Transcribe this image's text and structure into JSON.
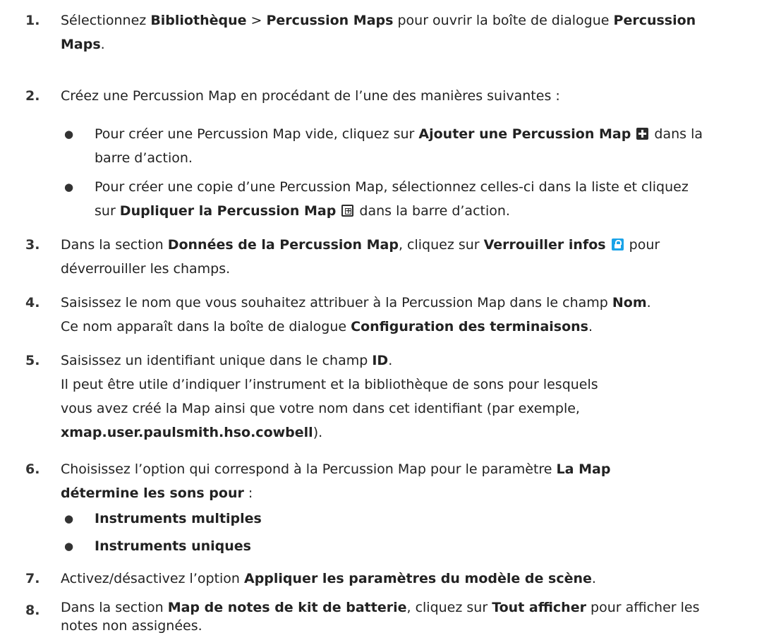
{
  "steps": [
    {
      "num": "1.",
      "lines": [
        {
          "a": "Sélectionnez ",
          "b1": "Bibliothèque",
          "c": " > ",
          "b2": "Percussion Maps",
          "d": " pour ouvrir la boîte de dialogue ",
          "b3": "Percussion"
        },
        {
          "b1": "Maps",
          "a": "."
        }
      ]
    },
    {
      "num": "2.",
      "text": "Créez une Percussion Map en procédant de l’une des manières suivantes :"
    },
    {
      "bullets": [
        {
          "l1_a": "Pour créer une Percussion Map vide, cliquez sur ",
          "l1_b": "Ajouter une Percussion Map",
          "l1_icon": "add-icon",
          "l1_c": " dans la",
          "l2": "barre d’action."
        },
        {
          "l1": "Pour créer une copie d’une Percussion Map, sélectionnez celles-ci dans la liste et cliquez",
          "l2_a": "sur ",
          "l2_b": "Dupliquer la Percussion Map",
          "l2_icon": "duplicate-icon",
          "l2_c": " dans la barre d’action."
        }
      ]
    },
    {
      "num": "3.",
      "l1_a": "Dans la section ",
      "l1_b": "Données de la Percussion Map",
      "l1_c": ", cliquez sur ",
      "l1_d": "Verrouiller infos",
      "l1_icon": "lock-icon",
      "l1_e": " pour",
      "l2": "déverrouiller les champs."
    },
    {
      "num": "4.",
      "l1_a": "Saisissez le nom que vous souhaitez attribuer à la Percussion Map dans le champ ",
      "l1_b": "Nom",
      "l1_c": ".",
      "l2_a": "Ce nom apparaît dans la boîte de dialogue ",
      "l2_b": "Configuration des terminaisons",
      "l2_c": "."
    },
    {
      "num": "5.",
      "l1_a": "Saisissez un identifiant unique dans le champ ",
      "l1_b": "ID",
      "l1_c": ".",
      "l2": "Il peut être utile d’indiquer l’instrument et la bibliothèque de sons pour lesquels",
      "l3": "vous avez créé la Map ainsi que votre nom dans cet identifiant (par exemple,",
      "l4_b": "xmap.user.paulsmith.hso.cowbell",
      "l4_c": ")."
    },
    {
      "num": "6.",
      "l1_a": "Choisissez l’option qui correspond à la Percussion Map pour le paramètre ",
      "l1_b": "La Map",
      "l2_b": "détermine les sons pour",
      "l2_c": " :"
    },
    {
      "bullets": [
        {
          "b": "Instruments multiples"
        },
        {
          "b": "Instruments uniques"
        }
      ]
    },
    {
      "num": "7.",
      "l1_a": "Activez/désactivez l’option ",
      "l1_b": "Appliquer les paramètres du modèle de scène",
      "l1_c": "."
    },
    {
      "num": "8.",
      "l1_a": "Dans la section ",
      "l1_b": "Map de notes de kit de batterie",
      "l1_c": ", cliquez sur ",
      "l1_d": "Tout afficher",
      "l1_e": " pour afficher les",
      "l2": "notes non assignées."
    }
  ],
  "bullet_glyph": "●"
}
